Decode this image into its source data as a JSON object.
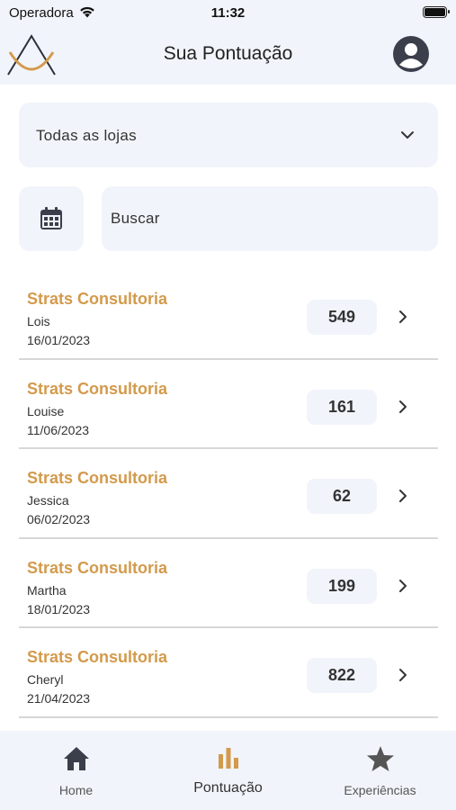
{
  "status_bar": {
    "carrier": "Operadora",
    "time": "11:32"
  },
  "header": {
    "title": "Sua Pontuação",
    "logo_icon": "mountain-logo-icon",
    "profile_icon": "user-avatar-icon"
  },
  "filters": {
    "store_select": {
      "selected": "Todas as lojas"
    },
    "search": {
      "placeholder": "Buscar"
    }
  },
  "list": {
    "items": [
      {
        "title": "Strats Consultoria",
        "name": "Lois",
        "date": "16/01/2023",
        "score": "549"
      },
      {
        "title": "Strats Consultoria",
        "name": "Louise",
        "date": "11/06/2023",
        "score": "161"
      },
      {
        "title": "Strats Consultoria",
        "name": "Jessica",
        "date": "06/02/2023",
        "score": "62"
      },
      {
        "title": "Strats Consultoria",
        "name": "Martha",
        "date": "18/01/2023",
        "score": "199"
      },
      {
        "title": "Strats Consultoria",
        "name": "Cheryl",
        "date": "21/04/2023",
        "score": "822"
      }
    ]
  },
  "bottom_nav": {
    "items": [
      {
        "label": "Home",
        "icon": "home-icon"
      },
      {
        "label": "Pontuação",
        "icon": "bar-chart-icon",
        "active": true
      },
      {
        "label": "Experiências",
        "icon": "star-icon"
      }
    ]
  },
  "colors": {
    "accent": "#d39a4b",
    "surface": "#f1f4fa",
    "icon_dark": "#3a3f4b"
  }
}
